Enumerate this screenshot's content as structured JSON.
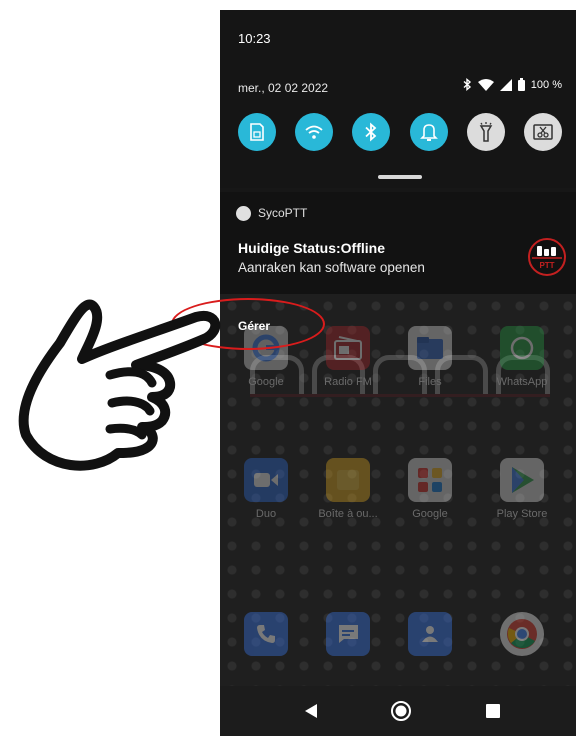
{
  "status": {
    "time": "10:23",
    "date": "mer., 02 02 2022",
    "battery": "100 %"
  },
  "quick_settings": [
    {
      "name": "sim-card",
      "state": "on"
    },
    {
      "name": "wifi",
      "state": "on"
    },
    {
      "name": "bluetooth",
      "state": "on"
    },
    {
      "name": "notification-bell",
      "state": "on"
    },
    {
      "name": "flashlight",
      "state": "off"
    },
    {
      "name": "screenshot",
      "state": "off"
    }
  ],
  "notification": {
    "app_name": "SycoPTT",
    "title": "Huidige Status:Offline",
    "body": "Aanraken kan software openen",
    "logo_text": "PTT"
  },
  "manage_label": "Gérer",
  "apps": [
    {
      "label": "Google",
      "color": "#dddddd"
    },
    {
      "label": "Radio FM",
      "color": "#b3262b"
    },
    {
      "label": "Files",
      "color": "#3a6fd0"
    },
    {
      "label": "WhatsApp",
      "color": "#25a545"
    },
    {
      "label": "Duo",
      "color": "#2f6fe0"
    },
    {
      "label": "Boîte à ou...",
      "color": "#e8b020"
    },
    {
      "label": "Google",
      "color": "#e8e8e8"
    },
    {
      "label": "Play Store",
      "color": "#e8e8e8"
    },
    {
      "label": "",
      "color": "#3a76e8"
    },
    {
      "label": "",
      "color": "#3a76e8"
    },
    {
      "label": "",
      "color": "#3a76e8"
    },
    {
      "label": "",
      "color": "#e8e8e8"
    }
  ],
  "colors": {
    "toggle_on": "#29b8d8",
    "toggle_off": "#dcdcdc",
    "highlight": "#d91c1c"
  }
}
